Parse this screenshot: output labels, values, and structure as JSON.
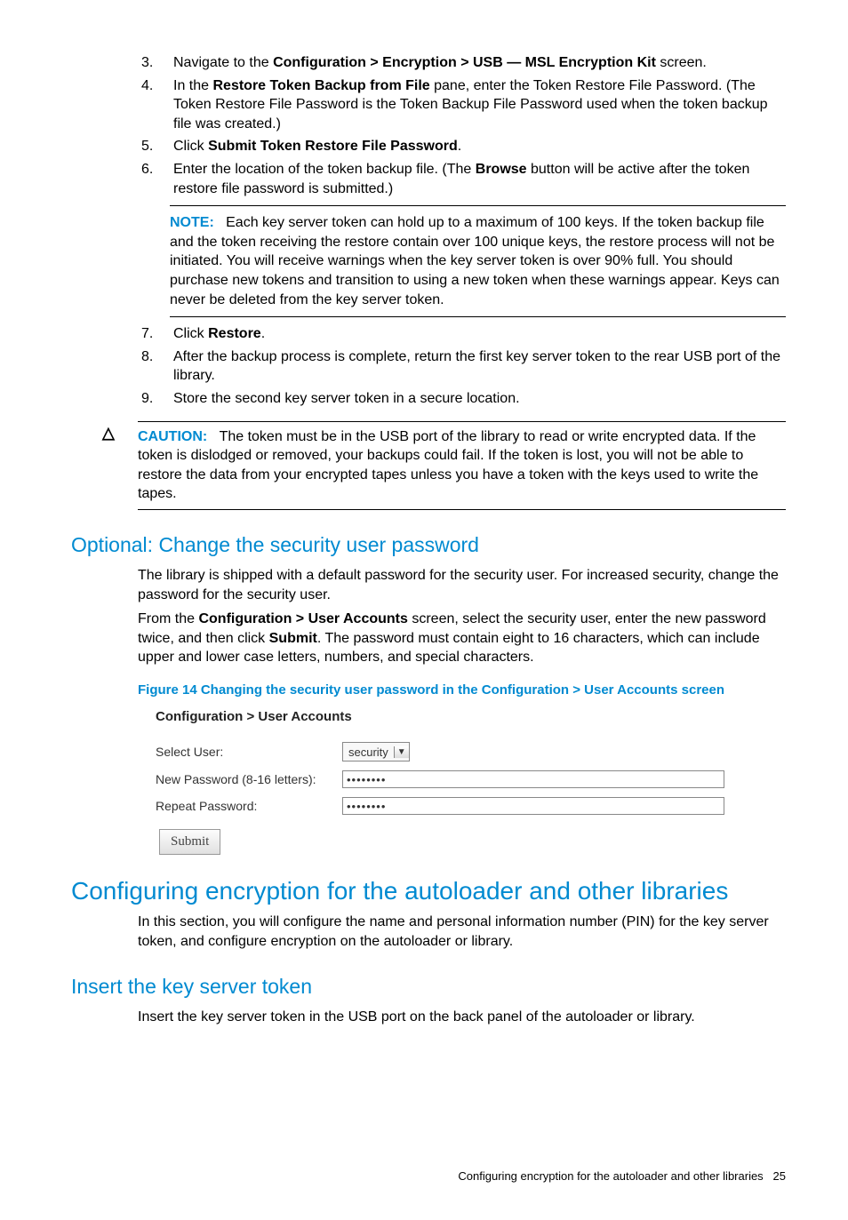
{
  "steps_top": [
    {
      "n": "3.",
      "pre": "Navigate to the ",
      "b1": "Configuration > Encryption > USB — MSL Encryption Kit",
      "post": " screen."
    },
    {
      "n": "4.",
      "pre": "In the ",
      "b1": "Restore Token Backup from File",
      "post": " pane, enter the Token Restore File Password. (The Token Restore File Password is the Token Backup File Password used when the token backup file was created.)"
    },
    {
      "n": "5.",
      "pre": "Click ",
      "b1": "Submit Token Restore File Password",
      "post": "."
    },
    {
      "n": "6.",
      "pre": "Enter the location of the token backup file. (The ",
      "b1": "Browse",
      "post": " button will be active after the token restore file password is submitted.)"
    }
  ],
  "note": {
    "label": "NOTE:",
    "text": "Each key server token can hold up to a maximum of 100 keys. If the token backup file and the token receiving the restore contain over 100 unique keys, the restore process will not be initiated. You will receive warnings when the key server token is over 90% full. You should purchase new tokens and transition to using a new token when these warnings appear. Keys can never be deleted from the key server token."
  },
  "steps_bottom": [
    {
      "n": "7.",
      "pre": "Click ",
      "b1": "Restore",
      "post": "."
    },
    {
      "n": "8.",
      "pre": "After the backup process is complete, return the first key server token to the rear USB port of the library.",
      "b1": "",
      "post": ""
    },
    {
      "n": "9.",
      "pre": "Store the second key server token in a secure location.",
      "b1": "",
      "post": ""
    }
  ],
  "caution": {
    "icon": "△",
    "label": "CAUTION:",
    "text": "The token must be in the USB port of the library to read or write encrypted data. If the token is dislodged or removed, your backups could fail. If the token is lost, you will not be able to restore the data from your encrypted tapes unless you have a token with the keys used to write the tapes."
  },
  "sec_optional": {
    "title": "Optional: Change the security user password",
    "p1": "The library is shipped with a default password for the security user. For increased security, change the password for the security user.",
    "p2_pre": "From the ",
    "p2_b1": "Configuration > User Accounts",
    "p2_mid": " screen, select the security user, enter the new password twice, and then click ",
    "p2_b2": "Submit",
    "p2_post": ". The password must contain eight to 16 characters, which can include upper and lower case letters, numbers, and special characters.",
    "fig_caption": "Figure 14 Changing the security user password in the Configuration > User Accounts screen"
  },
  "shot": {
    "breadcrumb": "Configuration > User Accounts",
    "row1_label": "Select User:",
    "row1_value": "security",
    "row2_label": "New Password (8-16 letters):",
    "row2_value": "••••••••",
    "row3_label": "Repeat Password:",
    "row3_value": "••••••••",
    "submit": "Submit"
  },
  "sec_config": {
    "title": "Configuring encryption for the autoloader and other libraries",
    "p1": "In this section, you will configure the name and personal information number (PIN) for the key server token, and configure encryption on the autoloader or library."
  },
  "sec_insert": {
    "title": "Insert the key server token",
    "p1": "Insert the key server token in the USB port on the back panel of the autoloader or library."
  },
  "footer": {
    "text": "Configuring encryption for the autoloader and other libraries",
    "page": "25"
  }
}
